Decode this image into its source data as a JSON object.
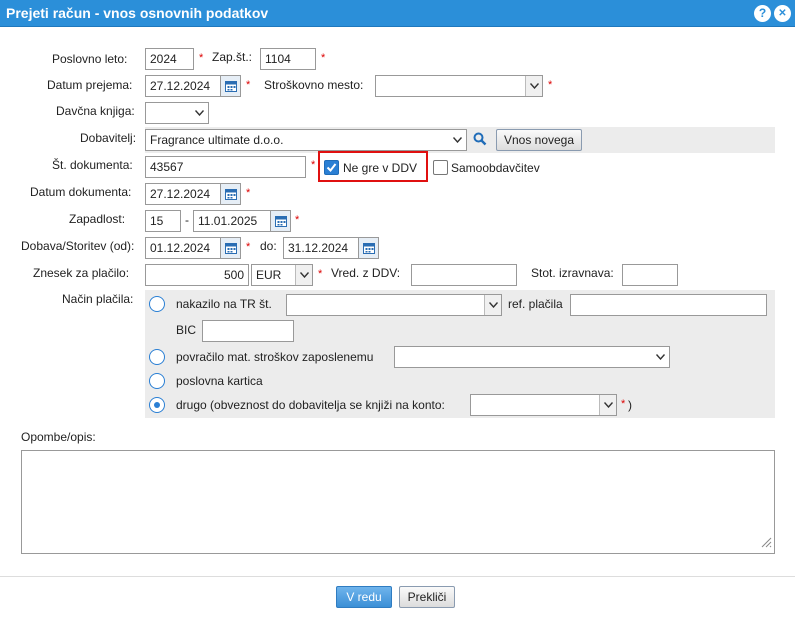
{
  "window": {
    "title": "Prejeti račun - vnos osnovnih podatkov",
    "help_glyph": "?",
    "close_glyph": "✕"
  },
  "form": {
    "poslovno_leto": {
      "label": "Poslovno leto:",
      "value": "2024"
    },
    "zap_st": {
      "label": "Zap.št.:",
      "value": "1104"
    },
    "datum_prejema": {
      "label": "Datum prejema:",
      "value": "27.12.2024"
    },
    "stroskovno_mesto": {
      "label": "Stroškovno mesto:",
      "value": ""
    },
    "davcna_knjiga": {
      "label": "Davčna knjiga:",
      "value": ""
    },
    "dobavitelj": {
      "label": "Dobavitelj:",
      "value": "Fragrance ultimate d.o.o.",
      "new_button": "Vnos novega"
    },
    "st_dokumenta": {
      "label": "Št. dokumenta:",
      "value": "43567"
    },
    "ne_gre_v_ddv": {
      "label": "Ne gre v DDV",
      "checked": true
    },
    "samoobdavcitev": {
      "label": "Samoobdavčitev",
      "checked": false
    },
    "datum_dokumenta": {
      "label": "Datum dokumenta:",
      "value": "27.12.2024"
    },
    "zapadlost": {
      "label": "Zapadlost:",
      "days": "15",
      "sep": "-",
      "date": "11.01.2025"
    },
    "dobava": {
      "label": "Dobava/Storitev (od):",
      "from": "01.12.2024",
      "do_label": "do:",
      "to": "31.12.2024"
    },
    "znesek": {
      "label": "Znesek za plačilo:",
      "value": "500",
      "currency": "EUR"
    },
    "vred_z_ddv": {
      "label": "Vred. z DDV:",
      "value": ""
    },
    "stot_izravnava": {
      "label": "Stot. izravnava:",
      "value": ""
    },
    "nacin_placila": {
      "label": "Način plačila:",
      "options": {
        "nakazilo": {
          "label": "nakazilo na TR št.",
          "ref_label": "ref. plačila",
          "bic_label": "BIC",
          "selected": false
        },
        "povracilo": {
          "label": "povračilo mat. stroškov zaposlenemu",
          "selected": false
        },
        "kartica": {
          "label": "poslovna kartica",
          "selected": false
        },
        "drugo": {
          "label": "drugo (obveznost do dobavitelja se knjiži na konto:",
          "closing": ")",
          "selected": true
        }
      }
    },
    "opombe": {
      "label": "Opombe/opis:",
      "value": ""
    },
    "required_mark": "*"
  },
  "footer": {
    "ok": "V redu",
    "cancel": "Prekliči"
  },
  "colors": {
    "title_bar": "#2b8fd9",
    "highlight": "#e01010",
    "required": "#d00000"
  },
  "icons": [
    "help-icon",
    "close-icon",
    "calendar-icon",
    "search-icon",
    "chevron-down-icon",
    "checkmark-icon",
    "resize-grip-icon"
  ]
}
